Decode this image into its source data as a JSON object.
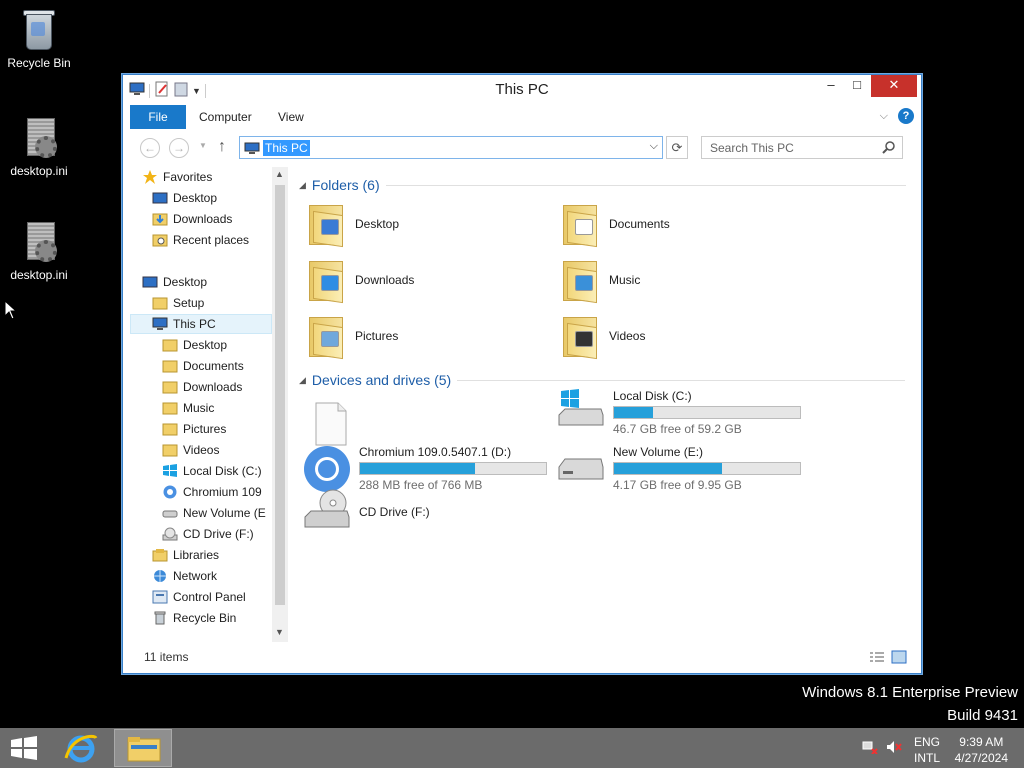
{
  "desktop": {
    "icons": [
      {
        "label": "Recycle Bin"
      },
      {
        "label": "desktop.ini"
      },
      {
        "label": "desktop.ini"
      }
    ]
  },
  "window": {
    "title": "This PC",
    "controls": {
      "minimize": "–",
      "maximize": "□",
      "close": "✕"
    },
    "ribbon": {
      "tabs": [
        "File",
        "Computer",
        "View"
      ],
      "help": "?"
    },
    "address": {
      "path": "This PC"
    },
    "search": {
      "placeholder": "Search This PC"
    },
    "nav": {
      "items": [
        {
          "label": "Favorites",
          "icon": "star-icon"
        },
        {
          "label": "Desktop",
          "icon": "desktop-icon"
        },
        {
          "label": "Downloads",
          "icon": "downloads-icon"
        },
        {
          "label": "Recent places",
          "icon": "recent-places-icon"
        },
        {
          "label": "Desktop",
          "icon": "desktop-icon"
        },
        {
          "label": "Setup",
          "icon": "folder-icon"
        },
        {
          "label": "This PC",
          "icon": "computer-icon"
        },
        {
          "label": "Desktop",
          "icon": "folder-icon"
        },
        {
          "label": "Documents",
          "icon": "folder-icon"
        },
        {
          "label": "Downloads",
          "icon": "folder-icon"
        },
        {
          "label": "Music",
          "icon": "folder-icon"
        },
        {
          "label": "Pictures",
          "icon": "folder-icon"
        },
        {
          "label": "Videos",
          "icon": "folder-icon"
        },
        {
          "label": "Local Disk (C:)",
          "icon": "windows-drive-icon"
        },
        {
          "label": "Chromium 109",
          "icon": "chromium-icon"
        },
        {
          "label": "New Volume (E",
          "icon": "drive-icon"
        },
        {
          "label": "CD Drive (F:)",
          "icon": "cd-drive-icon"
        },
        {
          "label": "Libraries",
          "icon": "libraries-icon"
        },
        {
          "label": "Network",
          "icon": "network-icon"
        },
        {
          "label": "Control Panel",
          "icon": "control-panel-icon"
        },
        {
          "label": "Recycle Bin",
          "icon": "recycle-bin-icon"
        }
      ]
    },
    "content": {
      "folders_header": "Folders (6)",
      "folders": [
        {
          "label": "Desktop",
          "badge": "#3a7bd5"
        },
        {
          "label": "Documents",
          "badge": "#ffffff"
        },
        {
          "label": "Downloads",
          "badge": "#2f8de4"
        },
        {
          "label": "Music",
          "badge": "#3a90d9"
        },
        {
          "label": "Pictures",
          "badge": "#6fa8dc"
        },
        {
          "label": "Videos",
          "badge": "#333333"
        }
      ],
      "devices_header": "Devices and drives (5)",
      "drives": [
        {
          "label": "Local Disk (C:)",
          "free": "46.7 GB free of 59.2 GB",
          "used_fraction": 0.21
        },
        {
          "label": "Chromium 109.0.5407.1 (D:)",
          "free": "288 MB free of 766 MB",
          "used_fraction": 0.62
        },
        {
          "label": "New Volume (E:)",
          "free": "4.17 GB free of 9.95 GB",
          "used_fraction": 0.58
        },
        {
          "label": "CD Drive (F:)"
        }
      ]
    },
    "status": {
      "count": "11 items"
    }
  },
  "watermark": {
    "line1": "Windows 8.1 Enterprise Preview",
    "line2": "Build 9431"
  },
  "taskbar": {
    "lang": {
      "line1": "ENG",
      "line2": "INTL"
    },
    "clock": {
      "time": "9:39 AM",
      "date": "4/27/2024"
    }
  },
  "colors": {
    "accent": "#1979ca",
    "bar_fill": "#26a0da",
    "close": "#c7312b"
  }
}
